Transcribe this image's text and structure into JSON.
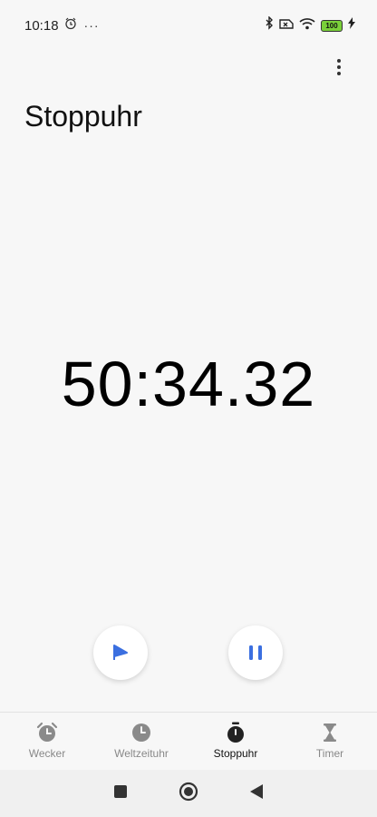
{
  "status_bar": {
    "time": "10:18",
    "more_indicator": "···",
    "battery": "100",
    "icons": [
      "alarm-icon",
      "bluetooth-icon",
      "sim-icon",
      "wifi-icon",
      "battery-icon",
      "charging-icon"
    ]
  },
  "header": {
    "title": "Stoppuhr",
    "menu_icon": "more-vert-icon"
  },
  "stopwatch": {
    "elapsed": "50:34.32"
  },
  "controls": {
    "lap_icon": "flag-icon",
    "pause_icon": "pause-icon",
    "accent_color": "#3b6fe0"
  },
  "tabs": [
    {
      "label": "Wecker",
      "icon": "alarm-clock-icon",
      "active": false
    },
    {
      "label": "Weltzeituhr",
      "icon": "clock-icon",
      "active": false
    },
    {
      "label": "Stoppuhr",
      "icon": "stopwatch-icon",
      "active": true
    },
    {
      "label": "Timer",
      "icon": "hourglass-icon",
      "active": false
    }
  ],
  "nav": {
    "icons": [
      "recents-icon",
      "home-icon",
      "back-icon"
    ]
  }
}
